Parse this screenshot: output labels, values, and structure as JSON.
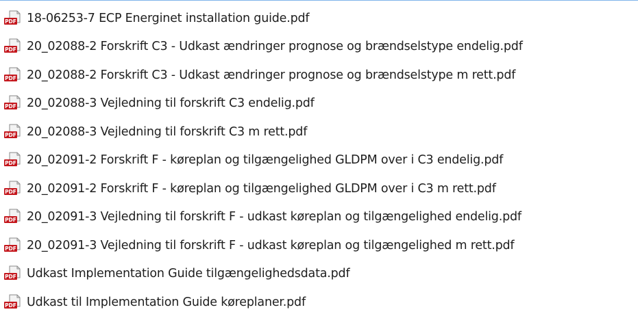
{
  "icons": {
    "file_type": "pdf-file-icon",
    "badge_text": "PDF",
    "badge_color": "#c4161c",
    "page_color": "#f3f3f3"
  },
  "files": [
    {
      "name": "18-06253-7 ECP Energinet installation guide.pdf"
    },
    {
      "name": "20_02088-2 Forskrift C3 - Udkast ændringer prognose og brændselstype endelig.pdf"
    },
    {
      "name": "20_02088-2 Forskrift C3 - Udkast ændringer prognose og brændselstype m rett.pdf"
    },
    {
      "name": "20_02088-3 Vejledning til forskrift C3 endelig.pdf"
    },
    {
      "name": "20_02088-3 Vejledning til forskrift C3 m rett.pdf"
    },
    {
      "name": "20_02091-2 Forskrift F - køreplan og tilgængelighed GLDPM over i C3 endelig.pdf"
    },
    {
      "name": "20_02091-2 Forskrift F - køreplan og tilgængelighed GLDPM over i C3 m rett.pdf"
    },
    {
      "name": "20_02091-3 Vejledning til forskrift F - udkast køreplan og tilgængelighed endelig.pdf"
    },
    {
      "name": "20_02091-3 Vejledning til forskrift F - udkast køreplan og tilgængelighed m rett.pdf"
    },
    {
      "name": "Udkast Implementation Guide tilgængelighedsdata.pdf"
    },
    {
      "name": "Udkast til Implementation Guide køreplaner.pdf"
    }
  ]
}
